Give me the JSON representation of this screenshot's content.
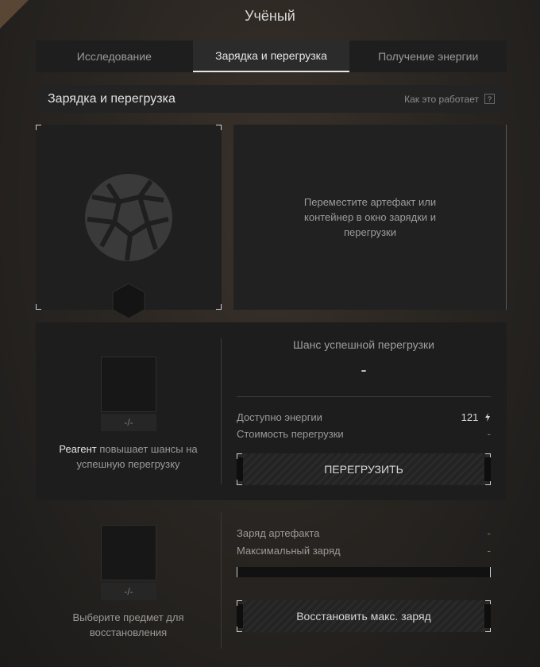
{
  "window_title": "Учёный",
  "tabs": [
    {
      "label": "Исследование"
    },
    {
      "label": "Зарядка и перегрузка"
    },
    {
      "label": "Получение энергии"
    }
  ],
  "section": {
    "title": "Зарядка и перегрузка",
    "help_label": "Как это работает",
    "help_icon": "?"
  },
  "drop_hint": "Переместите артефакт или контейнер в окно зарядки и перегрузки",
  "overload": {
    "reagent_slot_label": "-/-",
    "reagent_bold": "Реагент",
    "reagent_rest": " повышает шансы на успешную перегрузку",
    "chance_title": "Шанс успешной перегрузки",
    "chance_value": "-",
    "energy_label": "Доступно энергии",
    "energy_value": "121",
    "energy_icon": "lightning-icon",
    "cost_label": "Стоимость перегрузки",
    "cost_value": "-",
    "button_label": "ПЕРЕГРУЗИТЬ"
  },
  "restore": {
    "slot_label": "-/-",
    "hint": "Выберите предмет для восстановления",
    "charge_label": "Заряд артефакта",
    "charge_value": "-",
    "max_label": "Максимальный заряд",
    "max_value": "-",
    "progress": 0,
    "button_label": "Восстановить макс. заряд"
  }
}
